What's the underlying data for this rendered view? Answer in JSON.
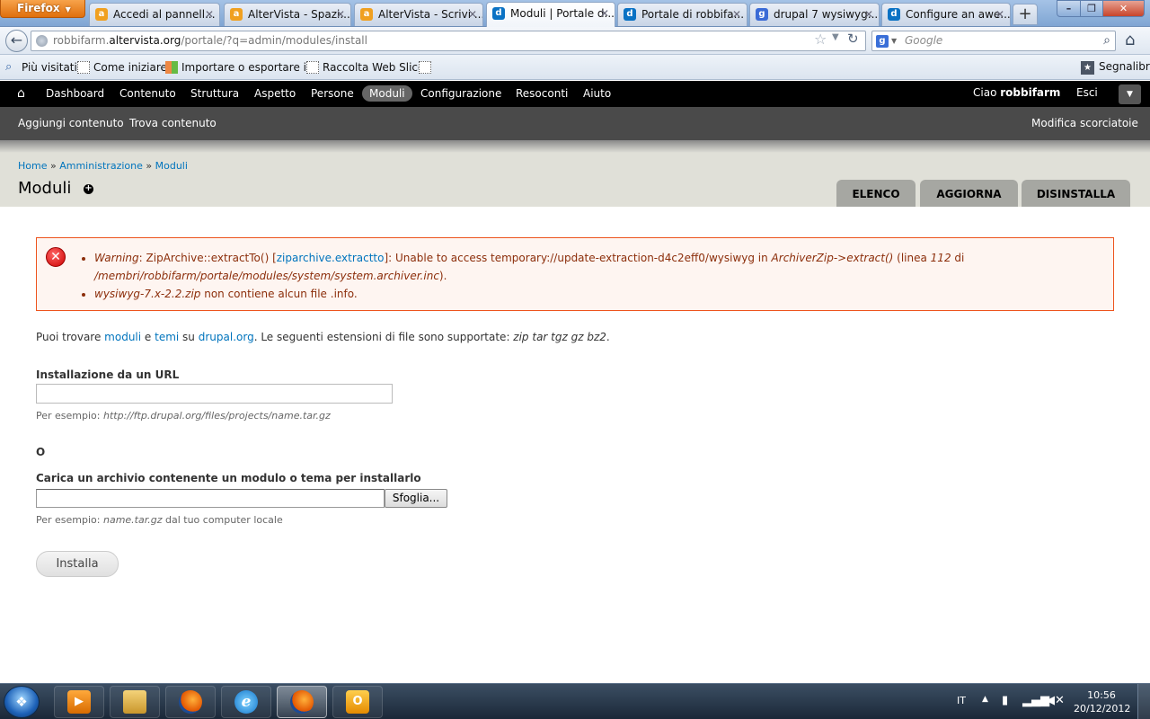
{
  "browser": {
    "menu_label": "Firefox",
    "tabs": [
      {
        "label": "Accedi al pannell...",
        "icon": "altervista-icon"
      },
      {
        "label": "AlterVista - Spazi...",
        "icon": "altervista-icon"
      },
      {
        "label": "AlterVista - Scrivi ...",
        "icon": "altervista-icon"
      },
      {
        "label": "Moduli | Portale d...",
        "icon": "drupal-icon",
        "active": true
      },
      {
        "label": "Portale di robbifa...",
        "icon": "drupal-icon"
      },
      {
        "label": "drupal 7 wysiwyg...",
        "icon": "google-icon"
      },
      {
        "label": "Configure an awe...",
        "icon": "drupal-icon"
      }
    ],
    "url": {
      "prefix": "robbifarm.",
      "host": "altervista.org",
      "path": "/portale/?q=admin/modules/install"
    },
    "search_placeholder": "Google",
    "bookmarks": [
      "Più visitati",
      "Come iniziare",
      "Importare o esportare i...",
      "Raccolta Web Slice"
    ],
    "bookmarks_menu": "Segnalibri"
  },
  "toolbar": {
    "items": [
      "Dashboard",
      "Contenuto",
      "Struttura",
      "Aspetto",
      "Persone",
      "Moduli",
      "Configurazione",
      "Resoconti",
      "Aiuto"
    ],
    "active": "Moduli",
    "greeting": "Ciao ",
    "username": "robbifarm",
    "logout": "Esci"
  },
  "shortcuts": {
    "items": [
      "Aggiungi contenuto",
      "Trova contenuto"
    ],
    "edit": "Modifica scorciatoie"
  },
  "header": {
    "breadcrumb": [
      "Home",
      "Amministrazione",
      "Moduli"
    ],
    "separator": " » ",
    "title": "Moduli",
    "tabs": [
      "Elenco",
      "Aggiorna",
      "Disinstalla"
    ]
  },
  "messages": {
    "error1": {
      "warning": "Warning",
      "text1": ": ZipArchive::extractTo() [",
      "link": "ziparchive.extractto",
      "text2": "]: Unable to access temporary://update-extraction-d4c2eff0/wysiwyg in ",
      "func": "ArchiverZip->extract()",
      "text3": " (linea ",
      "line": "112",
      "text4": " di ",
      "file": "/membri/robbifarm/portale/modules/system/system.archiver.inc",
      "text5": ")."
    },
    "error2": {
      "file": "wysiwyg-7.x-2.2.zip",
      "text": " non contiene alcun file .info."
    }
  },
  "content": {
    "intro": {
      "t1": "Puoi trovare ",
      "moduli": "moduli",
      "t2": " e ",
      "temi": "temi",
      "t3": " su ",
      "drupal": "drupal.org",
      "t4": ". Le seguenti estensioni di file sono supportate: ",
      "exts": "zip tar tgz gz bz2",
      "t5": "."
    },
    "url_label": "Installazione da un URL",
    "url_value": "",
    "url_desc_prefix": "Per esempio: ",
    "url_desc_example": "http://ftp.drupal.org/files/projects/name.tar.gz",
    "or": "O",
    "upload_label": "Carica un archivio contenente un modulo o tema per installarlo",
    "browse": "Sfoglia...",
    "upload_desc_prefix": "Per esempio: ",
    "upload_desc_example": "name.tar.gz",
    "upload_desc_suffix": " dal tuo computer locale",
    "install": "Installa"
  },
  "taskbar": {
    "lang": "IT",
    "time": "10:56",
    "date": "20/12/2012"
  }
}
